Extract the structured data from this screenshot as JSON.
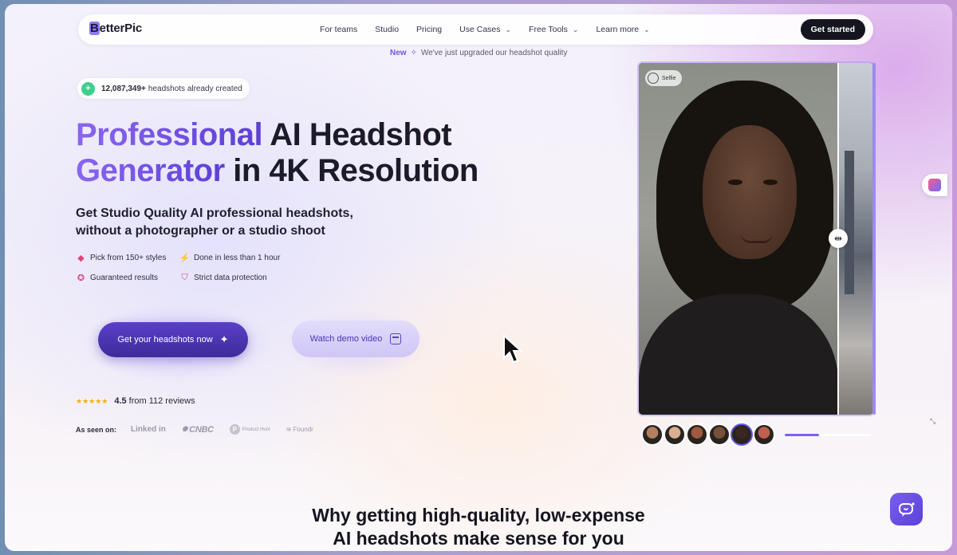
{
  "nav": {
    "logo": "BetterPic",
    "links": [
      "For teams",
      "Studio",
      "Pricing",
      "Use Cases",
      "Free Tools",
      "Learn more"
    ],
    "cta": "Get started"
  },
  "announcement": {
    "badge": "New",
    "text": "We've just upgraded our headshot quality"
  },
  "counter": {
    "number": "12,087,349+",
    "text": "headshots already created"
  },
  "hero": {
    "headline_line1_accent": "Professional",
    "headline_line1_rest": " AI Headshot",
    "headline_line2_accent": "Generator",
    "headline_line2_rest": " in 4K Resolution",
    "subhead_line1": "Get Studio Quality AI professional headshots,",
    "subhead_line2": "without a photographer or a studio shoot"
  },
  "features": [
    "Pick from 150+ styles",
    "Done in less than 1 hour",
    "Guaranteed results",
    "Strict data protection"
  ],
  "buttons": {
    "primary": "Get your headshots now",
    "secondary": "Watch demo video"
  },
  "reviews": {
    "stars": "★★★★★",
    "score": "4.5",
    "text": "from 112 reviews"
  },
  "press": {
    "label": "As seen on:",
    "outlets": [
      "Linked in",
      "CNBC",
      "Product Hunt",
      "Foundr"
    ]
  },
  "photo": {
    "tag": "Selfie"
  },
  "thumbnails": [
    "#b08060",
    "#d8b090",
    "#a05a40",
    "#7a5038",
    "#3a2820",
    "#c06050"
  ],
  "slider_progress": 0.4,
  "section": {
    "line1": "Why getting high-quality, low-expense",
    "line2": "AI headshots make sense for you"
  },
  "colors": {
    "accent": "#6b57e8",
    "dark": "#15151f"
  }
}
